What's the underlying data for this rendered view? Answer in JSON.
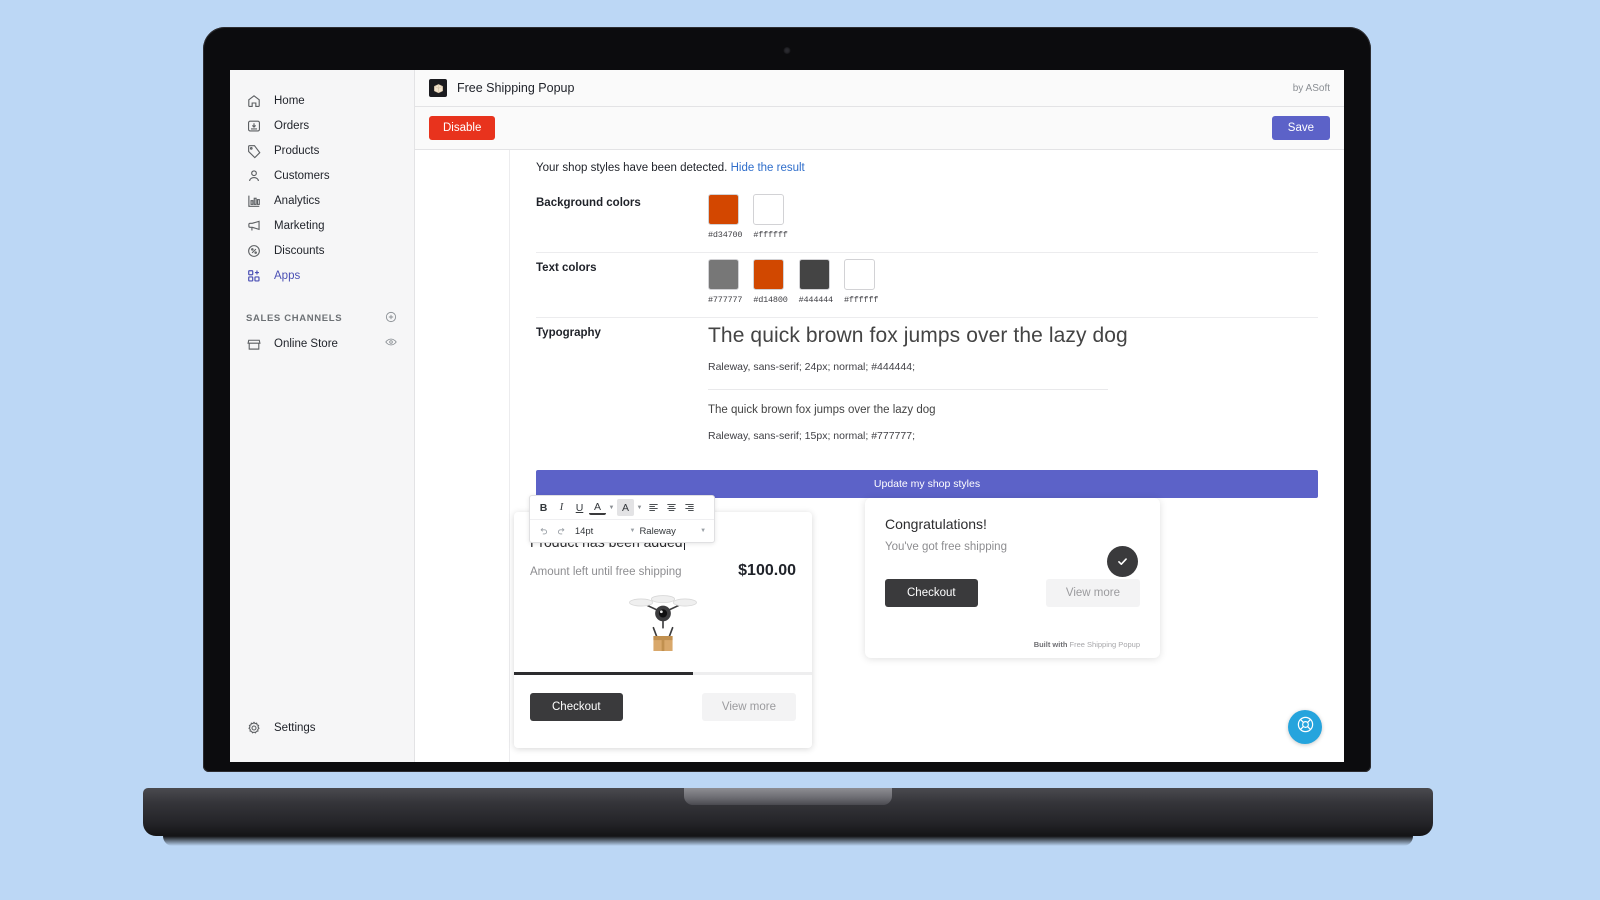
{
  "sidebar": {
    "items": [
      {
        "label": "Home",
        "icon": "home-icon",
        "active": false
      },
      {
        "label": "Orders",
        "icon": "orders-icon",
        "active": false
      },
      {
        "label": "Products",
        "icon": "products-icon",
        "active": false
      },
      {
        "label": "Customers",
        "icon": "customers-icon",
        "active": false
      },
      {
        "label": "Analytics",
        "icon": "analytics-icon",
        "active": false
      },
      {
        "label": "Marketing",
        "icon": "marketing-icon",
        "active": false
      },
      {
        "label": "Discounts",
        "icon": "discounts-icon",
        "active": false
      },
      {
        "label": "Apps",
        "icon": "apps-icon",
        "active": true
      }
    ],
    "sales_channels": {
      "title": "SALES CHANNELS",
      "add_icon": "plus-circle-icon",
      "store": {
        "label": "Online Store",
        "icon": "store-icon",
        "trailing_icon": "eye-icon"
      }
    },
    "settings": {
      "label": "Settings",
      "icon": "gear-icon"
    },
    "active_color": "#4b50b5"
  },
  "header": {
    "app_icon": "package-app-icon",
    "title": "Free Shipping Popup",
    "vendor": "by ASoft"
  },
  "action_bar": {
    "disable_label": "Disable",
    "disable_color": "#e8331d",
    "save_label": "Save",
    "save_color": "#5c62c8"
  },
  "styles_panel": {
    "banner_text": "Your shop styles have been detected.",
    "hide_link": "Hide the result",
    "hide_link_color": "#2f6ecb",
    "background_colors": {
      "label": "Background colors",
      "swatches": [
        {
          "hex": "#d34700",
          "label": "#d34700"
        },
        {
          "hex": "#ffffff",
          "label": "#ffffff"
        }
      ]
    },
    "text_colors": {
      "label": "Text colors",
      "swatches": [
        {
          "hex": "#777777",
          "label": "#777777"
        },
        {
          "hex": "#d14800",
          "label": "#d14800"
        },
        {
          "hex": "#444444",
          "label": "#444444"
        },
        {
          "hex": "#ffffff",
          "label": "#ffffff"
        }
      ]
    },
    "typography": {
      "label": "Typography",
      "sample_large": "The quick brown fox jumps over the lazy dog",
      "spec_large": "Raleway, sans-serif; 24px; normal; #444444;",
      "sample_small": "The quick brown fox jumps over the lazy dog",
      "spec_small": "Raleway, sans-serif; 15px; normal; #777777;"
    },
    "update_button_label": "Update my shop styles"
  },
  "editor_toolbar": {
    "bold": "B",
    "italic": "I",
    "underline": "U",
    "text_color": "A",
    "highlight_color": "A",
    "align_left": "align-left-icon",
    "align_center": "align-center-icon",
    "align_right": "align-right-icon",
    "undo": "undo-icon",
    "redo": "redo-icon",
    "font_size": "14pt",
    "font_family": "Raleway"
  },
  "popup_left": {
    "heading": "Product has been added",
    "amount_label": "Amount left until free shipping",
    "amount_value": "$100.00",
    "illustration": "drone-delivery-icon",
    "progress_percent": 60,
    "checkout_label": "Checkout",
    "view_more_label": "View more"
  },
  "popup_right": {
    "heading": "Congratulations!",
    "subtext": "You've got free shipping",
    "badge_icon": "check-circle-icon",
    "checkout_label": "Checkout",
    "view_more_label": "View more",
    "built_with_prefix": "Built with",
    "built_with_app": "Free Shipping Popup"
  },
  "help_bubble": {
    "icon": "lifebuoy-icon",
    "color": "#25a4dd"
  }
}
